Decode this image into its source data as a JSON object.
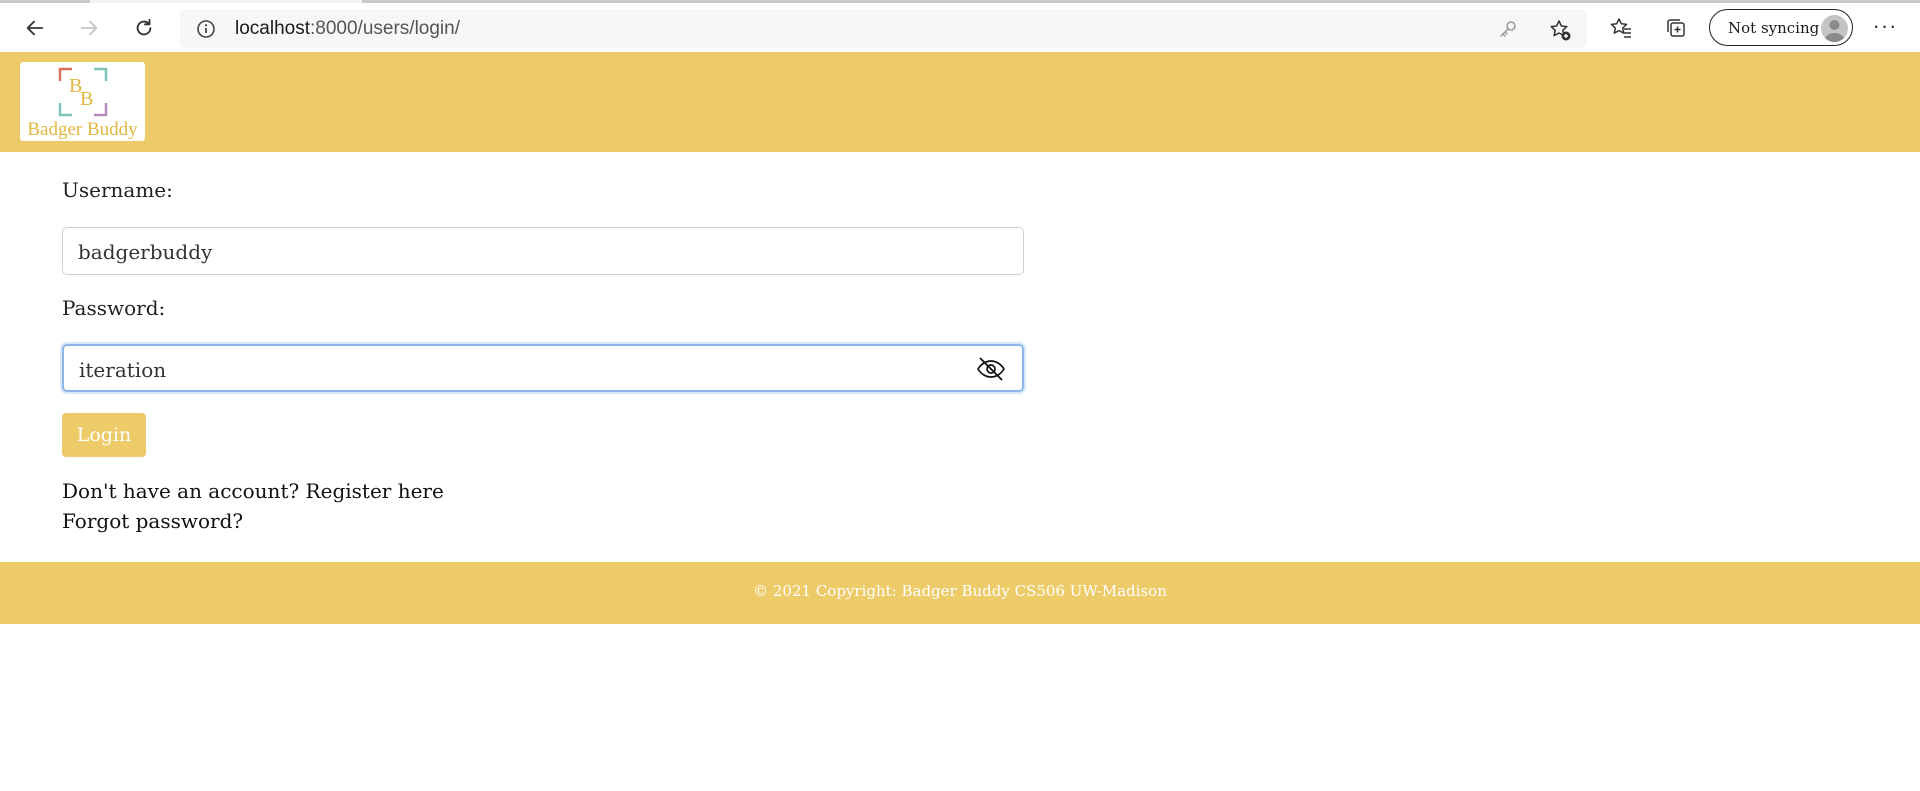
{
  "browser": {
    "url_host": "localhost",
    "url_path": ":8000/users/login/",
    "sync_label": "Not syncing",
    "icons": [
      "back-arrow-icon",
      "forward-arrow-icon",
      "refresh-icon",
      "info-icon",
      "key-icon",
      "star-add-icon",
      "favorites-icon",
      "collections-icon",
      "profile-avatar-icon",
      "more-icon"
    ]
  },
  "header": {
    "logo_letters": "BB",
    "logo_text": "Badger Buddy"
  },
  "form": {
    "username_label": "Username:",
    "username_value": "badgerbuddy",
    "password_label": "Password:",
    "password_value": "iteration",
    "login_label": "Login",
    "register_text": "Don't have an account? Register here",
    "forgot_text": "Forgot password?"
  },
  "footer": {
    "copyright": "© 2021 Copyright: Badger Buddy CS506 UW-Madison"
  },
  "colors": {
    "brand": "#eecb69",
    "focus": "#8fb4ea"
  }
}
